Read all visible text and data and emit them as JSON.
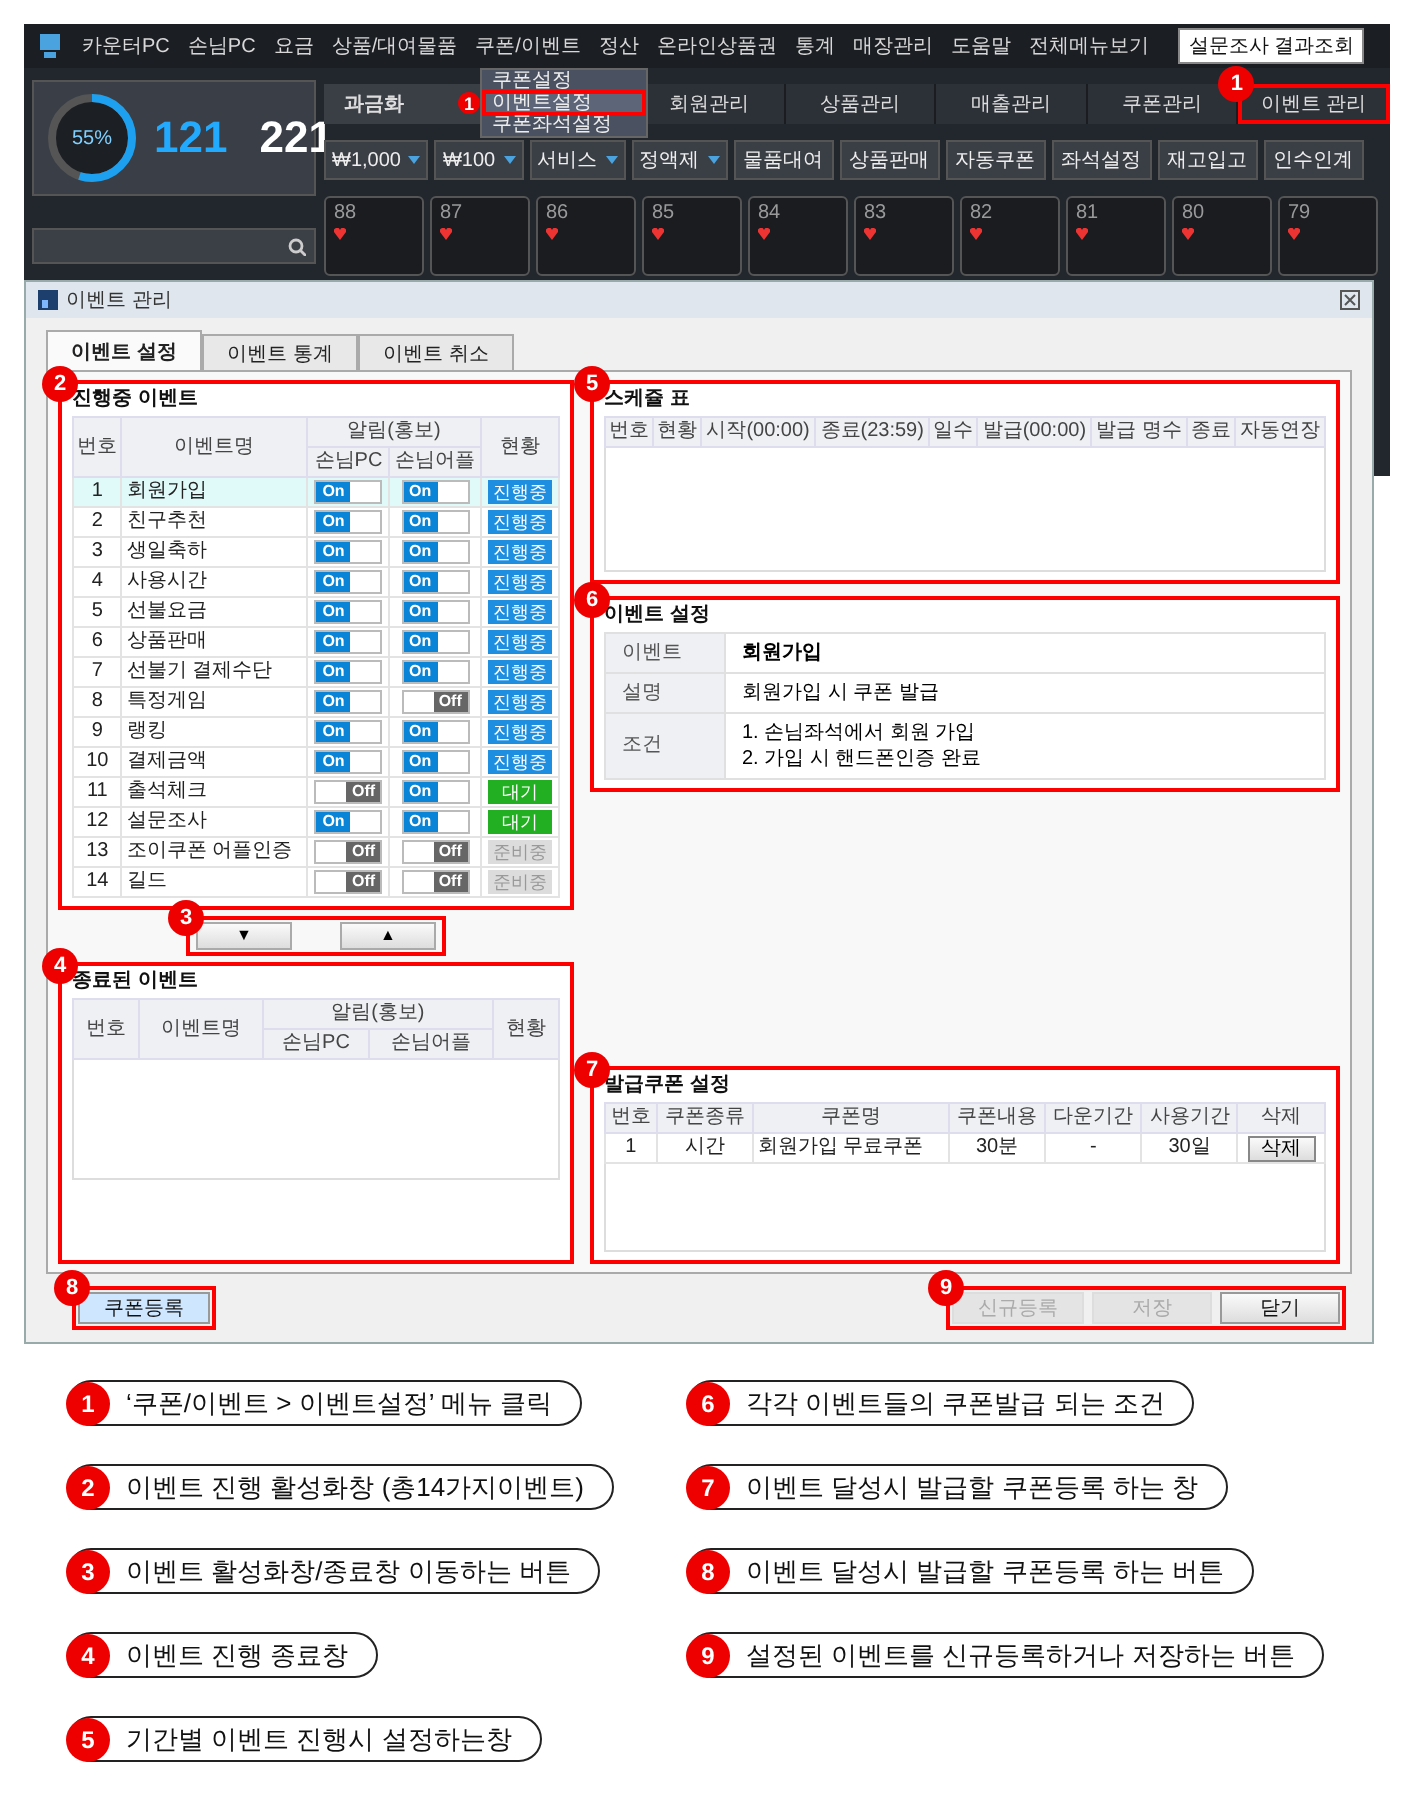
{
  "app": {
    "menu": [
      "카운터PC",
      "손님PC",
      "요금",
      "상품/대여물품",
      "쿠폰/이벤트",
      "정산",
      "온라인상품권",
      "통계",
      "매장관리",
      "도움말",
      "전체메뉴보기"
    ],
    "survey_button": "설문조사 결과조회",
    "submenu": [
      {
        "label": "쿠폰설정",
        "selected": false
      },
      {
        "label": "이벤트설정",
        "selected": true,
        "marker": "1"
      },
      {
        "label": "쿠폰좌석설정",
        "selected": false
      }
    ],
    "gauge": {
      "level": 0.55,
      "reading": "55%"
    },
    "seats_used": "121",
    "seats_total": "221",
    "tabs": [
      {
        "label": "과금화",
        "selected": true
      },
      {
        "label": "회원관리",
        "selected": false
      },
      {
        "label": "상품관리",
        "selected": false
      },
      {
        "label": "매출관리",
        "selected": false
      },
      {
        "label": "쿠폰관리",
        "selected": false
      },
      {
        "label": "이벤트 관리",
        "selected": false,
        "marker": "1"
      }
    ],
    "dropdowns": [
      "₩1,000",
      "₩100",
      "서비스",
      "정액제"
    ],
    "tool_buttons": [
      "물품대여",
      "상품판매",
      "자동쿠폰",
      "좌석설정",
      "재고입고",
      "인수인계"
    ],
    "seats": [
      "88",
      "87",
      "86",
      "85",
      "84",
      "83",
      "82",
      "81",
      "80",
      "79"
    ]
  },
  "dialog": {
    "title": "이벤트 관리",
    "tabs": [
      {
        "label": "이벤트 설정",
        "selected": true
      },
      {
        "label": "이벤트 통계",
        "selected": false
      },
      {
        "label": "이벤트 취소",
        "selected": false
      }
    ],
    "active_events": {
      "title": "진행중 이벤트",
      "marker": "2",
      "columns": {
        "no": "번호",
        "name": "이벤트명",
        "alarm": "알림(홍보)",
        "pc": "손님PC",
        "app": "손님어플",
        "status": "현황"
      },
      "rows": [
        {
          "no": "1",
          "name": "회원가입",
          "selected": true,
          "pc": {
            "label": "On",
            "on": true
          },
          "app": {
            "label": "On",
            "on": true
          },
          "status": {
            "label": "진행중",
            "kind": "running"
          }
        },
        {
          "no": "2",
          "name": "친구추천",
          "selected": false,
          "pc": {
            "label": "On",
            "on": true
          },
          "app": {
            "label": "On",
            "on": true
          },
          "status": {
            "label": "진행중",
            "kind": "running"
          }
        },
        {
          "no": "3",
          "name": "생일축하",
          "selected": false,
          "pc": {
            "label": "On",
            "on": true
          },
          "app": {
            "label": "On",
            "on": true
          },
          "status": {
            "label": "진행중",
            "kind": "running"
          }
        },
        {
          "no": "4",
          "name": "사용시간",
          "selected": false,
          "pc": {
            "label": "On",
            "on": true
          },
          "app": {
            "label": "On",
            "on": true
          },
          "status": {
            "label": "진행중",
            "kind": "running"
          }
        },
        {
          "no": "5",
          "name": "선불요금",
          "selected": false,
          "pc": {
            "label": "On",
            "on": true
          },
          "app": {
            "label": "On",
            "on": true
          },
          "status": {
            "label": "진행중",
            "kind": "running"
          }
        },
        {
          "no": "6",
          "name": "상품판매",
          "selected": false,
          "pc": {
            "label": "On",
            "on": true
          },
          "app": {
            "label": "On",
            "on": true
          },
          "status": {
            "label": "진행중",
            "kind": "running"
          }
        },
        {
          "no": "7",
          "name": "선불기 결제수단",
          "selected": false,
          "pc": {
            "label": "On",
            "on": true
          },
          "app": {
            "label": "On",
            "on": true
          },
          "status": {
            "label": "진행중",
            "kind": "running"
          }
        },
        {
          "no": "8",
          "name": "특정게임",
          "selected": false,
          "pc": {
            "label": "On",
            "on": true
          },
          "app": {
            "label": "Off",
            "on": false
          },
          "status": {
            "label": "진행중",
            "kind": "running"
          }
        },
        {
          "no": "9",
          "name": "랭킹",
          "selected": false,
          "pc": {
            "label": "On",
            "on": true
          },
          "app": {
            "label": "On",
            "on": true
          },
          "status": {
            "label": "진행중",
            "kind": "running"
          }
        },
        {
          "no": "10",
          "name": "결제금액",
          "selected": false,
          "pc": {
            "label": "On",
            "on": true
          },
          "app": {
            "label": "On",
            "on": true
          },
          "status": {
            "label": "진행중",
            "kind": "running"
          }
        },
        {
          "no": "11",
          "name": "출석체크",
          "selected": false,
          "pc": {
            "label": "Off",
            "on": false
          },
          "app": {
            "label": "On",
            "on": true
          },
          "status": {
            "label": "대기",
            "kind": "waiting"
          }
        },
        {
          "no": "12",
          "name": "설문조사",
          "selected": false,
          "pc": {
            "label": "On",
            "on": true
          },
          "app": {
            "label": "On",
            "on": true
          },
          "status": {
            "label": "대기",
            "kind": "waiting"
          }
        },
        {
          "no": "13",
          "name": "조이쿠폰 어플인증",
          "selected": false,
          "pc": {
            "label": "Off",
            "on": false
          },
          "app": {
            "label": "Off",
            "on": false
          },
          "status": {
            "label": "준비중",
            "kind": "preparing"
          }
        },
        {
          "no": "14",
          "name": "길드",
          "selected": false,
          "pc": {
            "label": "Off",
            "on": false
          },
          "app": {
            "label": "Off",
            "on": false
          },
          "status": {
            "label": "준비중",
            "kind": "preparing"
          }
        }
      ]
    },
    "move_buttons": {
      "marker": "3",
      "down": "▼",
      "up": "▲"
    },
    "ended_events": {
      "title": "종료된 이벤트",
      "marker": "4",
      "columns": {
        "no": "번호",
        "name": "이벤트명",
        "alarm": "알림(홍보)",
        "pc": "손님PC",
        "app": "손님어플",
        "status": "현황"
      }
    },
    "schedule": {
      "title": "스케쥴 표",
      "marker": "5",
      "columns": [
        "번호",
        "현황",
        "시작(00:00)",
        "종료(23:59)",
        "일수",
        "발급(00:00)",
        "발급 명수",
        "종료",
        "자동연장"
      ]
    },
    "event_settings": {
      "title": "이벤트 설정",
      "marker": "6",
      "rows": [
        {
          "label": "이벤트",
          "kind": "title",
          "lines": [
            "회원가입"
          ]
        },
        {
          "label": "설명",
          "kind": "text",
          "lines": [
            "회원가입 시 쿠폰 발급"
          ]
        },
        {
          "label": "조건",
          "kind": "text",
          "lines": [
            "1. 손님좌석에서 회원 가입",
            "2. 가입 시 핸드폰인증 완료"
          ]
        }
      ]
    },
    "coupon_settings": {
      "title": "발급쿠폰 설정",
      "marker": "7",
      "columns": [
        "번호",
        "쿠폰종류",
        "쿠폰명",
        "쿠폰내용",
        "다운기간",
        "사용기간",
        "삭제"
      ],
      "rows": [
        {
          "cells": [
            "1",
            "시간",
            "회원가입 무료쿠폰",
            "30분",
            "-",
            "30일"
          ],
          "action": "삭제"
        }
      ]
    },
    "footer": {
      "register": "쿠폰등록",
      "register_marker": "8",
      "actions_marker": "9",
      "actions": [
        {
          "label": "신규등록",
          "disabled": true
        },
        {
          "label": "저장",
          "disabled": true
        },
        {
          "label": "닫기",
          "disabled": false
        }
      ]
    }
  },
  "legend": [
    {
      "number": "1",
      "text": "‘쿠폰/이벤트 > 이벤트설정’ 메뉴 클릭"
    },
    {
      "number": "2",
      "text": "이벤트 진행 활성화창 (총14가지이벤트)"
    },
    {
      "number": "3",
      "text": "이벤트 활성화창/종료창 이동하는 버튼"
    },
    {
      "number": "4",
      "text": "이벤트 진행 종료창"
    },
    {
      "number": "5",
      "text": "기간별 이벤트 진행시 설정하는창"
    },
    {
      "number": "6",
      "text": "각각 이벤트들의 쿠폰발급 되는 조건"
    },
    {
      "number": "7",
      "text": "이벤트 달성시 발급할 쿠폰등록 하는 창"
    },
    {
      "number": "8",
      "text": "이벤트 달성시 발급할 쿠폰등록 하는 버튼"
    },
    {
      "number": "9",
      "text": "설정된 이벤트를 신규등록하거나 저장하는 버튼"
    }
  ]
}
